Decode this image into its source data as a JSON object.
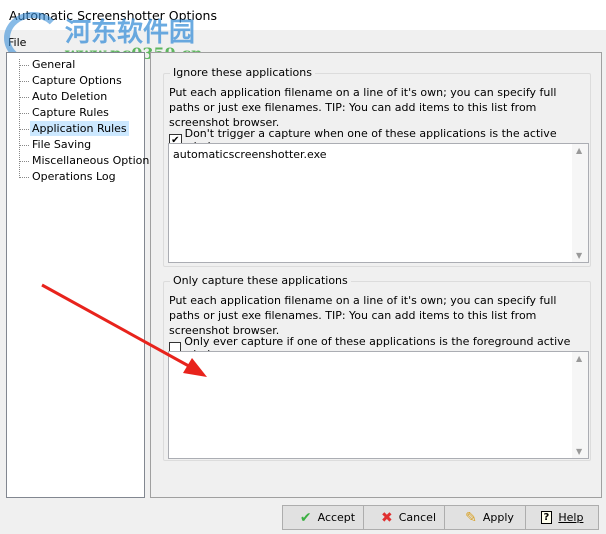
{
  "window": {
    "title": "Automatic Screenshotter Options",
    "menu": [
      "File"
    ]
  },
  "watermark": {
    "text": "河东软件园",
    "url": "www.pc0359.cn"
  },
  "sidebar": {
    "items": [
      {
        "label": "General"
      },
      {
        "label": "Capture Options"
      },
      {
        "label": "Auto Deletion"
      },
      {
        "label": "Capture Rules"
      },
      {
        "label": "Application Rules",
        "selected": true
      },
      {
        "label": "File Saving"
      },
      {
        "label": "Miscellaneous Options"
      },
      {
        "label": "Operations Log"
      }
    ]
  },
  "ignore": {
    "title": "Ignore these applications",
    "desc": "Put each application filename on a line of it's own; you can specify full paths or just exe filenames. TIP: You can add items to this list from screenshot browser.",
    "checkbox": "Don't trigger a capture when one of these applications is the active window:",
    "checked": true,
    "value": "automaticscreenshotter.exe"
  },
  "only": {
    "title": "Only capture these applications",
    "desc": "Put each application filename on a line of it's own; you can specify full paths or just exe filenames. TIP: You can add items to this list from screenshot browser.",
    "checkbox": "Only ever capture if one of these applications is the foreground active window:",
    "checked": false,
    "value": ""
  },
  "buttons": {
    "accept": "Accept",
    "cancel": "Cancel",
    "apply": "Apply",
    "help": "Help"
  },
  "colors": {
    "arrow": "#e8231c",
    "selection": "#cce8ff"
  }
}
